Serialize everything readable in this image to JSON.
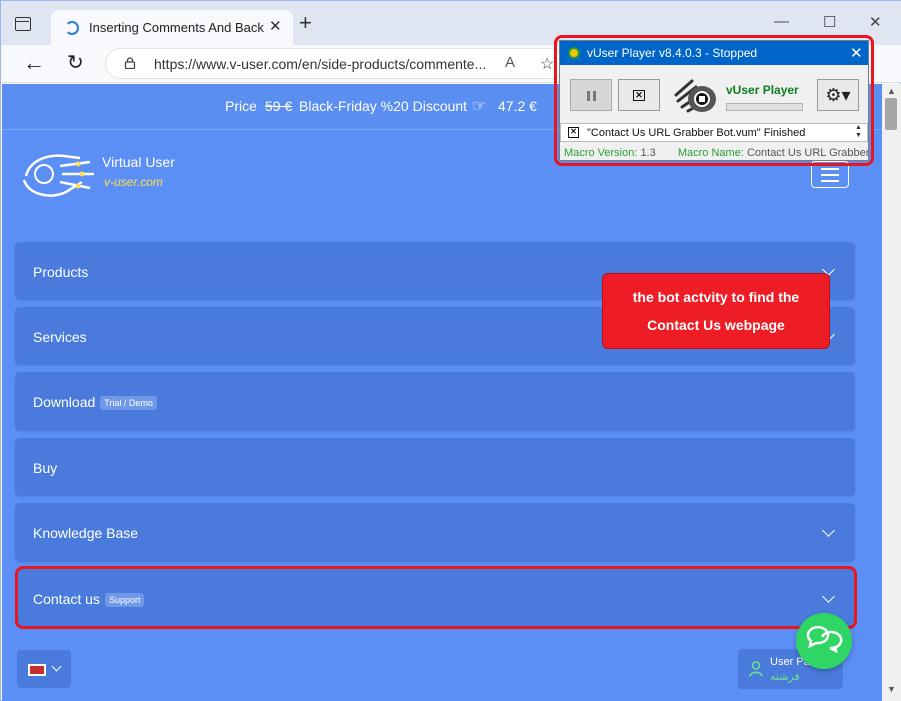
{
  "browser": {
    "tab_title": "Inserting Comments And Backlin",
    "tab_close": "✕",
    "new_tab": "+",
    "window_controls": {
      "minimize": "—",
      "maximize": "☐",
      "close": "✕"
    },
    "nav": {
      "back": "←",
      "refresh": "↻"
    },
    "url": "https://www.v-user.com/en/side-products/commente...",
    "read_aloud": "A",
    "favorite": "☆"
  },
  "promo": {
    "price_label": "Price",
    "old_price": "59 €",
    "discount_text": "Black-Friday %20 Discount",
    "hand_icon": "☞",
    "new_price": "47.2 €"
  },
  "logo": {
    "name": "Virtual User",
    "url": "v-user.com"
  },
  "menu": [
    {
      "label": "Products",
      "badge": "",
      "chevron": true
    },
    {
      "label": "Services",
      "badge": "",
      "chevron": true
    },
    {
      "label": "Download",
      "badge": "Trial / Demo",
      "chevron": false
    },
    {
      "label": "Buy",
      "badge": "",
      "chevron": false
    },
    {
      "label": "Knowledge Base",
      "badge": "",
      "chevron": true
    },
    {
      "label": "Contact us",
      "badge": "Support",
      "chevron": true
    }
  ],
  "user_panel": {
    "label": "User Pa",
    "label_fa": "فرشته"
  },
  "callout": {
    "line1": "the bot actvity to find the",
    "line2": "Contact Us webpage"
  },
  "player": {
    "title": "vUser Player v8.4.0.3 - Stopped",
    "close": "✕",
    "name": "vUser Player",
    "stop_glyph": "✕",
    "settings_glyph": "⚙▾",
    "status": "\"Contact Us URL Grabber Bot.vum\" Finished",
    "macro_version_label": "Macro Version:",
    "macro_version": "1.3",
    "macro_name_label": "Macro Name:",
    "macro_name": "Contact Us URL Grabber Bo"
  },
  "scrollbar": {
    "up": "▲",
    "down": "▼"
  },
  "colors": {
    "page_bg": "#5b8ff5",
    "menu_bg": "#4a7bdc",
    "highlight": "#e8161f",
    "callout": "#ee1c24",
    "player_titlebar": "#0065c8",
    "whatsapp": "#2fd565"
  }
}
